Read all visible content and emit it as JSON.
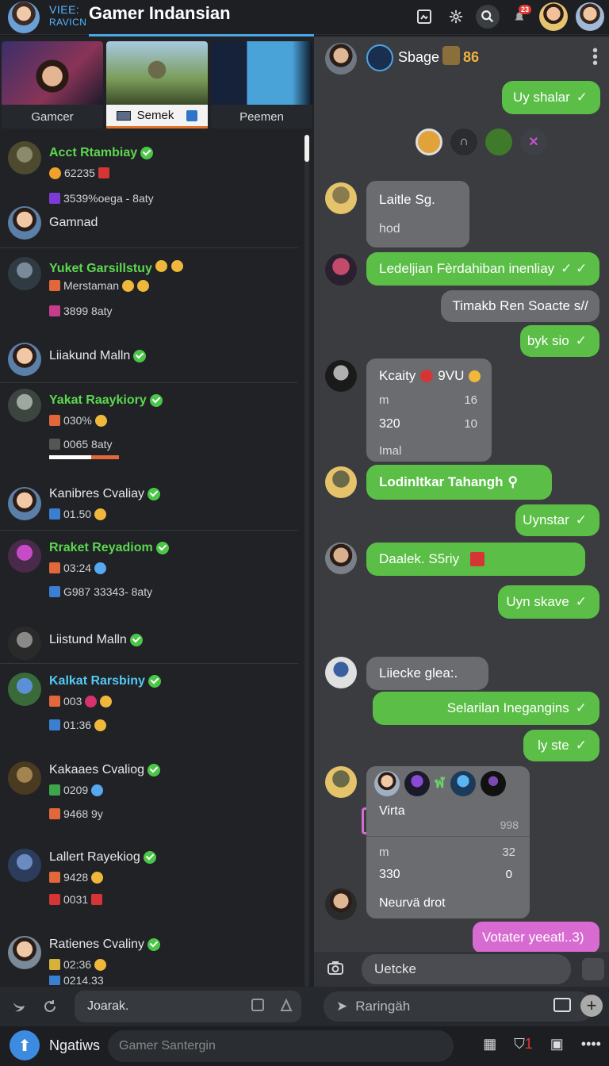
{
  "header": {
    "brand_line1": "VIEE:",
    "brand_line2": "RAVICN",
    "title": "Gamer Indansian",
    "notif_count": "23"
  },
  "thumbnails": [
    {
      "label": "Gamcer"
    },
    {
      "label": "Semek"
    },
    {
      "label": "Peemen"
    }
  ],
  "conversations": [
    {
      "name": "Acct Rtambiay",
      "line2": "62235",
      "line3": "3539%oega - 8aty"
    },
    {
      "name": "Gamnad"
    },
    {
      "name": "Yuket Garsillstuy",
      "line2": "Merstaman",
      "line3": "3899 8aty"
    },
    {
      "name": "Liiakund Malln"
    },
    {
      "name": "Yakat Raaykiory",
      "line2": "030%",
      "line3": "0065 8aty",
      "progress": 0.6
    },
    {
      "name": "Kanibres Cvaliay",
      "line2": "01.50"
    },
    {
      "name": "Rraket Reyadiom",
      "line2": "03:24",
      "line3": "G987 33343- 8aty"
    },
    {
      "name": "Liistund Malln"
    },
    {
      "name": "Kalkat Rarsbiny",
      "line2": "003",
      "line3": "01:36"
    },
    {
      "name": "Kakaaes Cvaliog",
      "line2": "0209",
      "line3": "9468 9y"
    },
    {
      "name": "Lallert Rayekiog",
      "line2": "9428",
      "line3": "0031"
    },
    {
      "name": "Ratienes Cvaliny",
      "line2": "02:36",
      "line3": "0214.33"
    }
  ],
  "left_composer": {
    "placeholder": "Joarak."
  },
  "chat": {
    "contact": "Sbage",
    "count": "86",
    "messages": {
      "m1": "Uy shalar",
      "m2_title": "Laitle Sg.",
      "m2_sub": "hod",
      "m3": "Ledeljian Fèrdahiban inenliay",
      "m4": "Timakb Ren Soacte s//",
      "m5": "byk sio",
      "m6_title": "Kcaity",
      "m6_extra": "9VU",
      "m6_r1a": "m",
      "m6_r1b": "16",
      "m6_r2a": "320",
      "m6_r2b": "10",
      "m6_foot": "Imal",
      "m7": "Lodinltkar Tahangh",
      "m8": "Uynstar",
      "m9": "Daalek. S5riy",
      "m10": "Uyn skave",
      "m11": "Liiecke glea:.",
      "m12": "Selarilan Inegangins",
      "m13": "ly ste",
      "m14_title": "Virta",
      "m14_val": "998",
      "m14_r1a": "m",
      "m14_r1b": "32",
      "m14_r2a": "330",
      "m14_r2b": "0",
      "m14_foot": "Neurvä drot",
      "m15": "Votater yeeatl..3)"
    }
  },
  "right_composer": {
    "text": "Uetcke",
    "placeholder": "Raringäh"
  },
  "bottom": {
    "label": "Ngatiws",
    "search_placeholder": "Gamer Santergin"
  },
  "colors": {
    "accent": "#4aa5e6",
    "bubble_out": "#5bbf47",
    "bubble_in": "#6a6c70",
    "pink": "#d86bd1"
  }
}
